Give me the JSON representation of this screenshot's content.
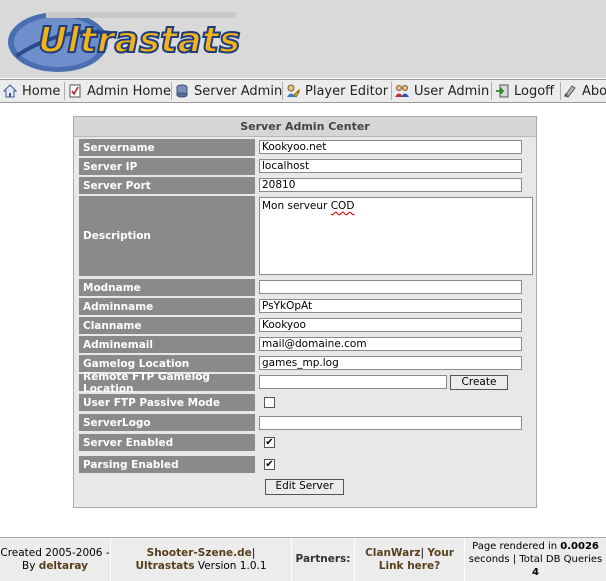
{
  "logo": {
    "text": "Ultrastats"
  },
  "nav": {
    "items": [
      {
        "label": "Home",
        "icon": "home-icon"
      },
      {
        "label": "Admin Home",
        "icon": "document-icon"
      },
      {
        "label": "Server Admin",
        "icon": "database-icon"
      },
      {
        "label": "Player Editor",
        "icon": "player-icon"
      },
      {
        "label": "User Admin",
        "icon": "users-icon"
      },
      {
        "label": "Logoff",
        "icon": "logoff-icon"
      },
      {
        "label": "Abo",
        "icon": "about-icon"
      }
    ]
  },
  "panel": {
    "title": "Server Admin Center",
    "fields": {
      "servername": {
        "label": "Servername",
        "value": "Kookyoo.net"
      },
      "server_ip": {
        "label": "Server IP",
        "value": "localhost"
      },
      "server_port": {
        "label": "Server Port",
        "value": "20810"
      },
      "description": {
        "label": "Description",
        "value": "Mon serveur ",
        "value_underlined": "COD"
      },
      "modname": {
        "label": "Modname",
        "value": ""
      },
      "adminname": {
        "label": "Adminname",
        "value": "PsYkOpAt"
      },
      "clanname": {
        "label": "Clanname",
        "value": "Kookyoo"
      },
      "adminemail": {
        "label": "Adminemail",
        "value": "mail@domaine.com"
      },
      "gamelog": {
        "label": "Gamelog Location",
        "value": "games_mp.log"
      },
      "remote_ftp": {
        "label": "Remote FTP Gamelog Location",
        "value": "",
        "button": "Create"
      },
      "ftp_passive": {
        "label": "User FTP Passive Mode",
        "checked": false
      },
      "serverlogo": {
        "label": "ServerLogo",
        "value": ""
      },
      "server_enabled": {
        "label": "Server Enabled",
        "checked": true
      },
      "parsing_enabled": {
        "label": "Parsing Enabled",
        "checked": true
      }
    },
    "submit": "Edit Server"
  },
  "footer": {
    "created": "Created 2005-2006 -",
    "by": "By ",
    "author": "deltaray",
    "site": "Shooter-Szene.de",
    "pipe1": "|",
    "product": "Ultrastats",
    "version": " Version 1.0.1",
    "partners": "Partners:",
    "partner1": "ClanWarz",
    "pipe2": "|",
    "partner2a": "Your",
    "partner2b": "Link here?",
    "render1": "Page rendered in ",
    "render_time": "0.0026",
    "render2": "seconds ",
    "pipe3": "|",
    "render3": " Total DB Queries",
    "queries": "4"
  }
}
